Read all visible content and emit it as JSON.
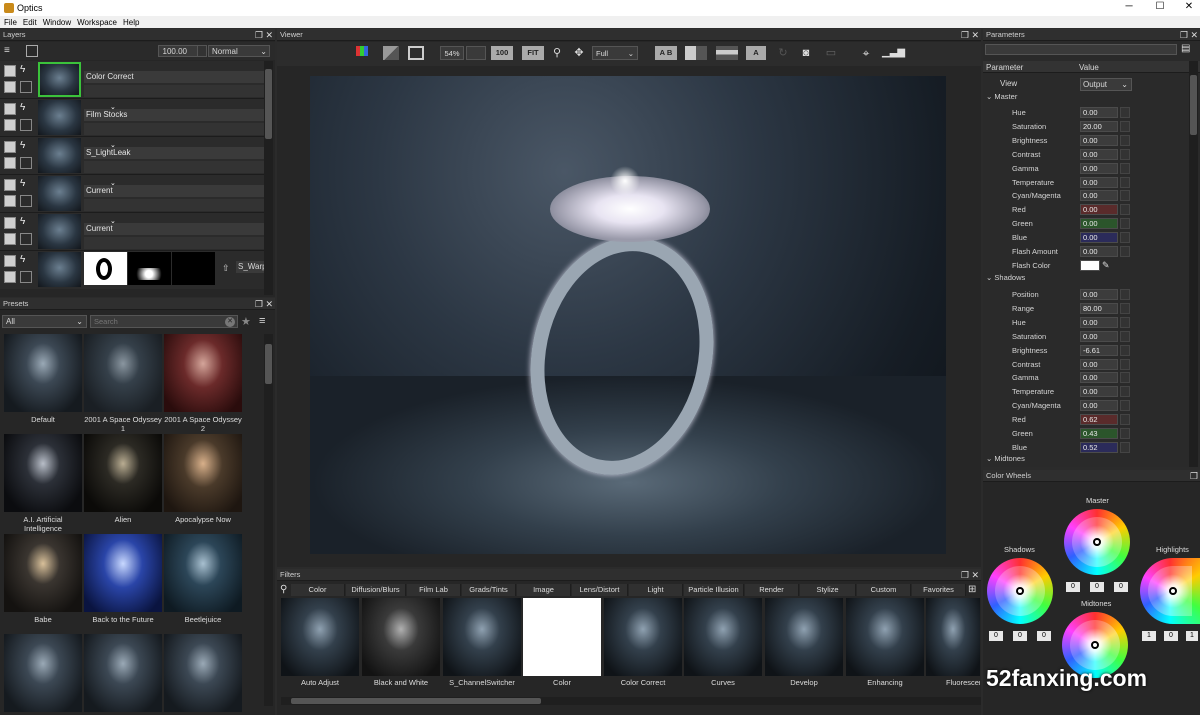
{
  "app": {
    "title": "Optics"
  },
  "menu": [
    "File",
    "Edit",
    "Window",
    "Workspace",
    "Help"
  ],
  "layers": {
    "title": "Layers",
    "opacity": "100.00",
    "blend_mode": "Normal",
    "rows": [
      {
        "name": "Color Correct"
      },
      {
        "name": "Film Stocks"
      },
      {
        "name": "S_LightLeak"
      },
      {
        "name": "Current"
      },
      {
        "name": "Current"
      },
      {
        "name": "S_Warp"
      }
    ]
  },
  "presets": {
    "title": "Presets",
    "category": "All",
    "search_placeholder": "Search",
    "items": [
      {
        "label": "Default"
      },
      {
        "label": "2001 A Space Odyssey 1"
      },
      {
        "label": "2001 A Space Odyssey 2"
      },
      {
        "label": "A.I. Artificial Intelligence"
      },
      {
        "label": "Alien"
      },
      {
        "label": "Apocalypse Now"
      },
      {
        "label": "Babe"
      },
      {
        "label": "Back to the Future"
      },
      {
        "label": "Beetlejuice"
      },
      {
        "label": ""
      },
      {
        "label": ""
      },
      {
        "label": ""
      }
    ]
  },
  "viewer": {
    "title": "Viewer",
    "zoom": "54%",
    "zoom_100": "100",
    "fit": "FIT",
    "resolution": "Full",
    "ab": "A B"
  },
  "parameters": {
    "title": "Parameters",
    "col_param": "Parameter",
    "col_value": "Value",
    "view_label": "View",
    "view_value": "Output",
    "master_label": "Master",
    "master": [
      {
        "name": "Hue",
        "value": "0.00",
        "color": "#3c3c3c"
      },
      {
        "name": "Saturation",
        "value": "20.00",
        "color": "#3c3c3c"
      },
      {
        "name": "Brightness",
        "value": "0.00",
        "color": "#3c3c3c"
      },
      {
        "name": "Contrast",
        "value": "0.00",
        "color": "#3c3c3c"
      },
      {
        "name": "Gamma",
        "value": "0.00",
        "color": "#3c3c3c"
      },
      {
        "name": "Temperature",
        "value": "0.00",
        "color": "#3c3c3c"
      },
      {
        "name": "Cyan/Magenta",
        "value": "0.00",
        "color": "#3c3c3c"
      },
      {
        "name": "Red",
        "value": "0.00",
        "color": "#5a2b2b"
      },
      {
        "name": "Green",
        "value": "0.00",
        "color": "#2b552b"
      },
      {
        "name": "Blue",
        "value": "0.00",
        "color": "#2b2b5a"
      },
      {
        "name": "Flash Amount",
        "value": "0.00",
        "color": "#3c3c3c"
      },
      {
        "name": "Flash Color",
        "value": "",
        "color": "#ffffff"
      }
    ],
    "shadows_label": "Shadows",
    "shadows": [
      {
        "name": "Position",
        "value": "0.00",
        "color": "#3c3c3c"
      },
      {
        "name": "Range",
        "value": "80.00",
        "color": "#3c3c3c"
      },
      {
        "name": "Hue",
        "value": "0.00",
        "color": "#3c3c3c"
      },
      {
        "name": "Saturation",
        "value": "0.00",
        "color": "#3c3c3c"
      },
      {
        "name": "Brightness",
        "value": "-6.61",
        "color": "#3c3c3c"
      },
      {
        "name": "Contrast",
        "value": "0.00",
        "color": "#3c3c3c"
      },
      {
        "name": "Gamma",
        "value": "0.00",
        "color": "#3c3c3c"
      },
      {
        "name": "Temperature",
        "value": "0.00",
        "color": "#3c3c3c"
      },
      {
        "name": "Cyan/Magenta",
        "value": "0.00",
        "color": "#3c3c3c"
      },
      {
        "name": "Red",
        "value": "0.62",
        "color": "#5a2b2b"
      },
      {
        "name": "Green",
        "value": "0.43",
        "color": "#2b552b"
      },
      {
        "name": "Blue",
        "value": "0.52",
        "color": "#2b2b5a"
      }
    ],
    "midtones_label": "Midtones"
  },
  "color_wheels": {
    "title": "Color Wheels",
    "master": "Master",
    "shadows": "Shadows",
    "highlights": "Highlights",
    "midtones": "Midtones",
    "zero": "0",
    "one": "1"
  },
  "filters": {
    "title": "Filters",
    "tabs": [
      "Color",
      "Diffusion/Blurs",
      "Film Lab",
      "Grads/Tints",
      "Image",
      "Lens/Distort",
      "Light",
      "Particle Illusion",
      "Render",
      "Stylize",
      "Custom",
      "Favorites"
    ],
    "items": [
      {
        "label": "Auto Adjust"
      },
      {
        "label": "Black and White"
      },
      {
        "label": "S_ChannelSwitcher"
      },
      {
        "label": "Color"
      },
      {
        "label": "Color Correct"
      },
      {
        "label": "Curves"
      },
      {
        "label": "Develop"
      },
      {
        "label": "Enhancing"
      },
      {
        "label": "Fluorescent"
      }
    ]
  },
  "watermark": "52fanxing.com"
}
